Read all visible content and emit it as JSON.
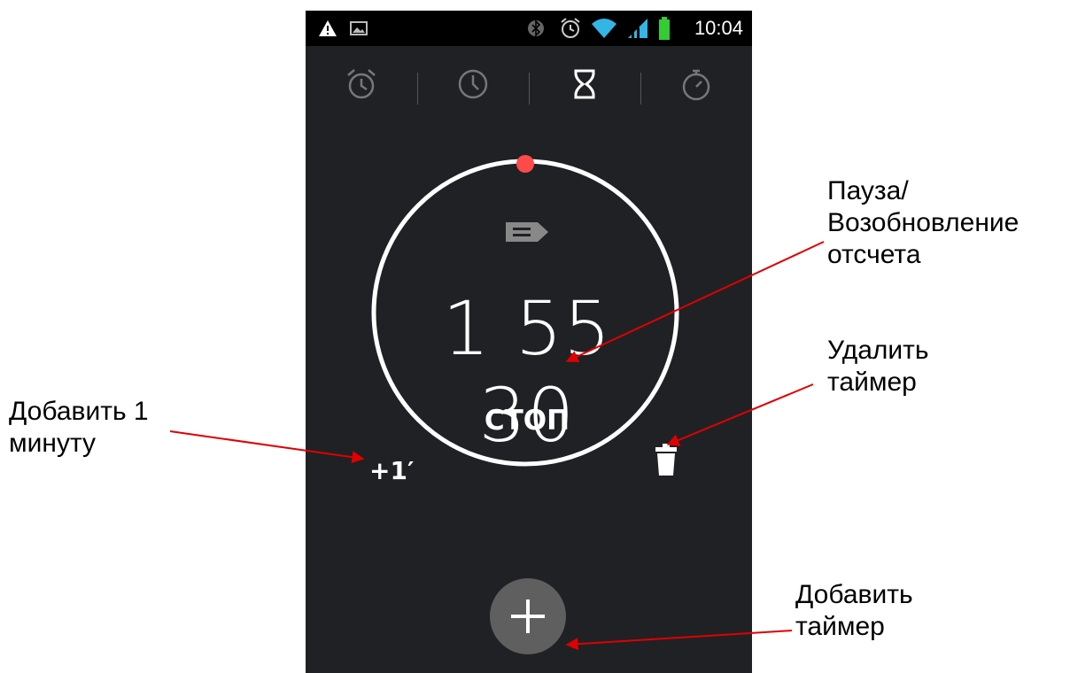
{
  "status_bar": {
    "time": "10:04",
    "left_icons": [
      "warning-icon",
      "image-icon"
    ],
    "right_icons": [
      "bluetooth-icon",
      "alarm-icon",
      "wifi-icon",
      "signal-icon",
      "battery-icon"
    ]
  },
  "tabs": [
    {
      "name": "alarm",
      "icon": "alarm-clock-icon",
      "active": false
    },
    {
      "name": "clock",
      "icon": "clock-icon",
      "active": false
    },
    {
      "name": "timer",
      "icon": "hourglass-icon",
      "active": true
    },
    {
      "name": "stopwatch",
      "icon": "stopwatch-icon",
      "active": false
    }
  ],
  "timer": {
    "value": "1 55 30",
    "stop_label": "СТОП",
    "add_minute_label": "+1′",
    "label_icon": "label-tag-icon",
    "delete_icon": "trash-icon",
    "progress_dot_color": "#ff4a4a"
  },
  "fab": {
    "icon": "plus-icon"
  },
  "annotations": {
    "pause_resume": [
      "Пауза/",
      "Возобновление",
      "отсчета"
    ],
    "delete_timer": [
      "Удалить",
      "таймер"
    ],
    "add_minute": [
      "Добавить 1",
      "минуту"
    ],
    "add_timer": [
      "Добавить",
      "таймер"
    ]
  },
  "colors": {
    "screen_bg": "#202124",
    "ring": "#ffffff",
    "accent": "#ff4a4a",
    "arrow": "#e00000",
    "fab": "#5f5f5f"
  }
}
